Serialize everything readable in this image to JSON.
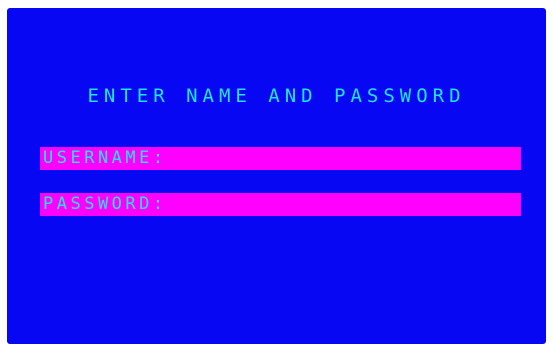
{
  "login": {
    "title": "ENTER NAME AND PASSWORD",
    "username_label": "USERNAME:",
    "username_value": "",
    "password_label": "PASSWORD:",
    "password_value": ""
  },
  "colors": {
    "screen_background": "#0707f3",
    "text": "#1fe6f7",
    "field_background": "#ff00ff",
    "outer_frame": "#ffffff"
  }
}
